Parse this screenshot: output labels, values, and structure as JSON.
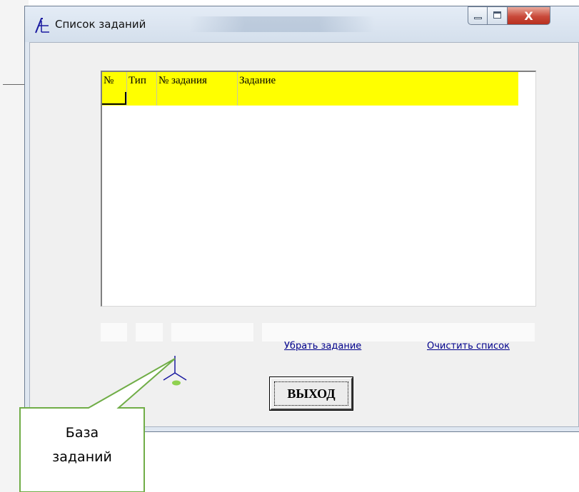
{
  "window": {
    "title": "Список заданий",
    "controls": {
      "minimize_icon": "minimize-icon",
      "maximize_icon": "maximize-icon",
      "close_label": "X"
    }
  },
  "grid": {
    "columns": [
      "№",
      "Тип",
      "№ задания",
      "Задание"
    ],
    "header_color": "#ffff00",
    "rows": []
  },
  "links": {
    "remove_task": "Убрать задание",
    "clear_list": "Очистить список"
  },
  "tasks_db_icon": "task-database-icon",
  "exit_button": "ВЫХОД",
  "callout": {
    "line1": "База",
    "line2": "заданий",
    "border_color": "#70ad47"
  }
}
